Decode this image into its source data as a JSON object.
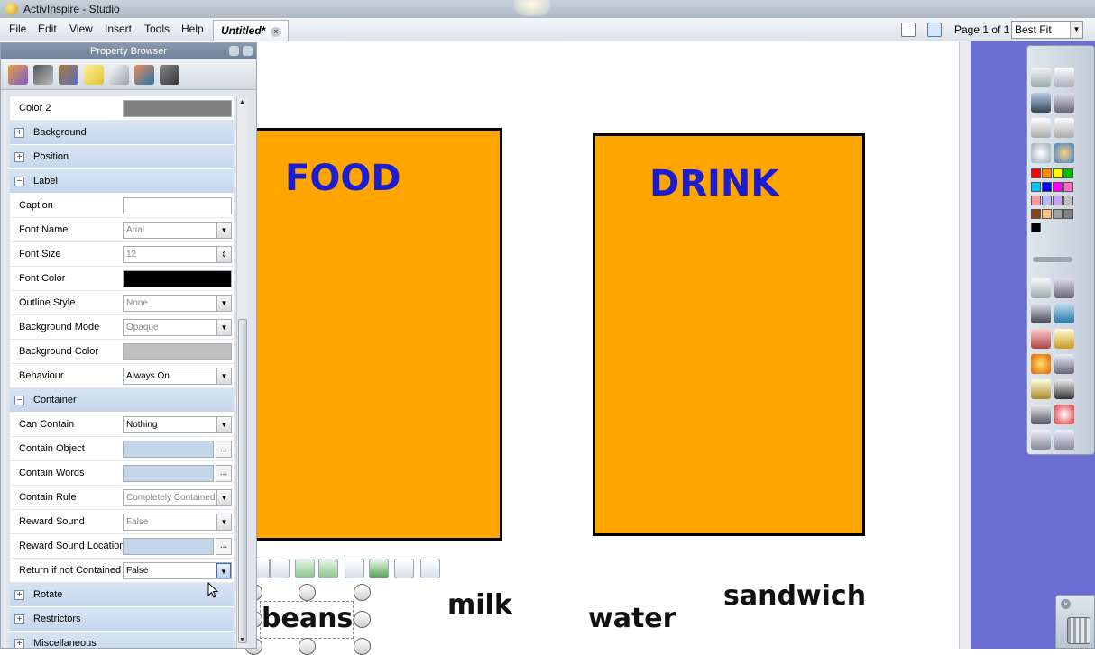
{
  "app": {
    "title": "ActivInspire - Studio"
  },
  "menu": {
    "items": [
      "File",
      "Edit",
      "View",
      "Insert",
      "Tools",
      "Help"
    ]
  },
  "document_tab": {
    "label": "Untitled*"
  },
  "page_indicator": "Page 1 of 1",
  "zoom": {
    "value": "Best Fit"
  },
  "property_browser": {
    "title": "Property Browser",
    "rows": [
      {
        "type": "property",
        "label": "Color 2",
        "control": "swatch",
        "color": "#808080"
      },
      {
        "type": "section",
        "label": "Background",
        "expanded": false
      },
      {
        "type": "section",
        "label": "Position",
        "expanded": false
      },
      {
        "type": "section",
        "label": "Label",
        "expanded": true
      },
      {
        "type": "property",
        "label": "Caption",
        "control": "text",
        "value": ""
      },
      {
        "type": "property",
        "label": "Font Name",
        "control": "dropdown",
        "value": "Arial",
        "enabled": false
      },
      {
        "type": "property",
        "label": "Font Size",
        "control": "spin",
        "value": "12",
        "enabled": false
      },
      {
        "type": "property",
        "label": "Font Color",
        "control": "swatch",
        "color": "#000000"
      },
      {
        "type": "property",
        "label": "Outline Style",
        "control": "dropdown",
        "value": "None",
        "enabled": false
      },
      {
        "type": "property",
        "label": "Background Mode",
        "control": "dropdown",
        "value": "Opaque",
        "enabled": false
      },
      {
        "type": "property",
        "label": "Background Color",
        "control": "swatch",
        "color": "#c0c0c0"
      },
      {
        "type": "property",
        "label": "Behaviour",
        "control": "dropdown",
        "value": "Always On",
        "enabled": true
      },
      {
        "type": "section",
        "label": "Container",
        "expanded": true
      },
      {
        "type": "property",
        "label": "Can Contain",
        "control": "dropdown",
        "value": "Nothing",
        "enabled": true
      },
      {
        "type": "property",
        "label": "Contain Object",
        "control": "browse",
        "value": ""
      },
      {
        "type": "property",
        "label": "Contain Words",
        "control": "browse",
        "value": ""
      },
      {
        "type": "property",
        "label": "Contain Rule",
        "control": "dropdown",
        "value": "Completely Contained",
        "enabled": false
      },
      {
        "type": "property",
        "label": "Reward Sound",
        "control": "dropdown",
        "value": "False",
        "enabled": false
      },
      {
        "type": "property",
        "label": "Reward Sound Location",
        "control": "browse",
        "value": ""
      },
      {
        "type": "property",
        "label": "Return if not Contained",
        "control": "dropdown",
        "value": "False",
        "enabled": true,
        "focused": true
      },
      {
        "type": "section",
        "label": "Rotate",
        "expanded": false
      },
      {
        "type": "section",
        "label": "Restrictors",
        "expanded": false
      },
      {
        "type": "section",
        "label": "Miscellaneous",
        "expanded": false
      }
    ]
  },
  "canvas": {
    "containers": [
      {
        "label": "FOOD",
        "fill": "#ffa500",
        "label_color": "#1d1dd0"
      },
      {
        "label": "DRINK",
        "fill": "#ffa500",
        "label_color": "#1d1dd0"
      }
    ],
    "words": [
      "beans",
      "milk",
      "water",
      "sandwich"
    ],
    "selected_word": "beans"
  },
  "toolbox": {
    "palette": [
      "#ff0000",
      "#ff8c00",
      "#ffff00",
      "#00c000",
      "#00c8ff",
      "#0000ff",
      "#ff00ff",
      "#ff6ec7",
      "#ff9999",
      "#b8b8ff",
      "#c9a0ff",
      "#c0c0c0",
      "#8b4513",
      "#ffc080",
      "#a0a0a0",
      "#808080",
      "#000000"
    ]
  },
  "colors": {
    "workspace_bg": "#6a6ed0",
    "panel_header": "#7b8da3",
    "section_bg": "#cedcee"
  }
}
